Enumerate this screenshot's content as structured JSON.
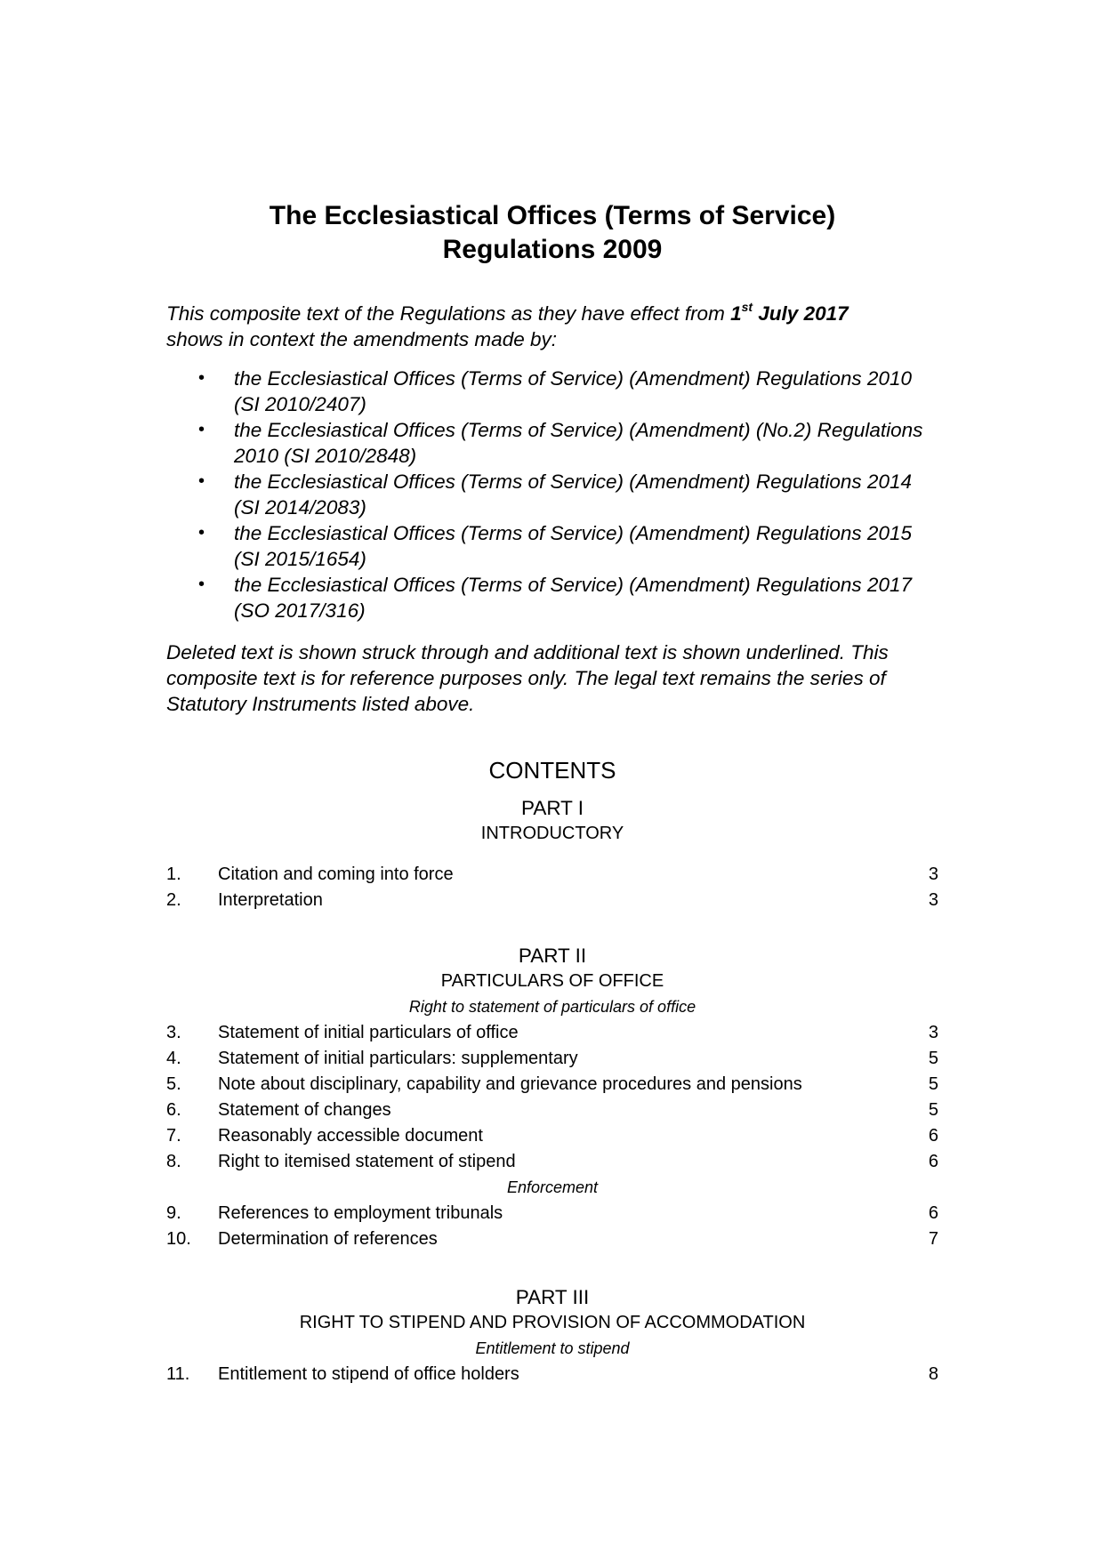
{
  "document": {
    "title_line1": "The Ecclesiastical Offices (Terms of Service)",
    "title_line2": "Regulations 2009",
    "intro": {
      "before_date": "This composite text of the Regulations as they have effect from ",
      "date_day": "1",
      "date_suffix": "st",
      "date_rest": " July 2017",
      "after_date": "shows in context the amendments made by:"
    },
    "amendments": [
      "the Ecclesiastical Offices (Terms of Service) (Amendment) Regulations 2010 (SI 2010/2407)",
      "the Ecclesiastical Offices (Terms of Service) (Amendment) (No.2) Regulations 2010 (SI 2010/2848)",
      "the Ecclesiastical Offices (Terms of Service) (Amendment) Regulations 2014 (SI 2014/2083)",
      "the Ecclesiastical Offices (Terms of Service) (Amendment) Regulations 2015 (SI 2015/1654)",
      "the Ecclesiastical Offices (Terms of Service) (Amendment) Regulations 2017 (SO 2017/316)"
    ],
    "bullet_glyph": "•",
    "note": "Deleted text is shown struck through and additional text is shown underlined. This composite text is for reference purposes only.  The legal text remains the series of Statutory Instruments listed above."
  },
  "contents": {
    "heading": "CONTENTS",
    "parts": [
      {
        "title": "PART I",
        "subtitle": "INTRODUCTORY",
        "groups": [
          {
            "heading": "",
            "entries": [
              {
                "num": "1.",
                "label": "Citation and coming into force",
                "page": "3"
              },
              {
                "num": "2.",
                "label": "Interpretation",
                "page": "3"
              }
            ]
          }
        ]
      },
      {
        "title": "PART II",
        "subtitle": "PARTICULARS OF OFFICE",
        "groups": [
          {
            "heading": "Right to statement of particulars of office",
            "entries": [
              {
                "num": "3.",
                "label": "Statement of initial particulars of office",
                "page": "3"
              },
              {
                "num": "4.",
                "label": "Statement of initial particulars: supplementary",
                "page": "5"
              },
              {
                "num": "5.",
                "label": "Note about disciplinary, capability and grievance procedures and pensions",
                "page": "5"
              },
              {
                "num": "6.",
                "label": "Statement of changes",
                "page": "5"
              },
              {
                "num": "7.",
                "label": "Reasonably accessible document",
                "page": "6"
              },
              {
                "num": "8.",
                "label": "Right to itemised statement of stipend",
                "page": "6"
              }
            ]
          },
          {
            "heading": "Enforcement",
            "entries": [
              {
                "num": "9.",
                "label": "References to employment tribunals",
                "page": "6"
              },
              {
                "num": "10.",
                "label": "Determination of references",
                "page": "7"
              }
            ]
          }
        ]
      },
      {
        "title": "PART III",
        "subtitle": "RIGHT TO STIPEND AND PROVISION OF ACCOMMODATION",
        "groups": [
          {
            "heading": "Entitlement to stipend",
            "entries": [
              {
                "num": "11.",
                "label": "Entitlement to stipend of office holders",
                "page": "8"
              }
            ]
          }
        ]
      }
    ]
  }
}
